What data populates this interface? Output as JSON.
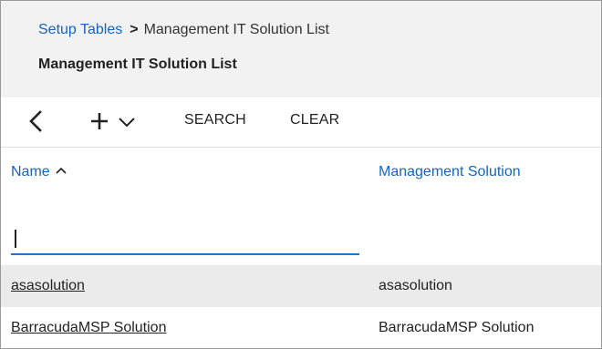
{
  "breadcrumb": {
    "parent": "Setup Tables",
    "separator": ">",
    "current": "Management IT Solution List"
  },
  "page_title": "Management IT Solution List",
  "toolbar": {
    "back_icon": "chevron-left-icon",
    "add_icon": "plus-icon",
    "add_menu_icon": "chevron-down-icon",
    "search_label": "SEARCH",
    "clear_label": "CLEAR"
  },
  "table": {
    "columns": [
      {
        "label": "Name",
        "sort": "ascending",
        "sort_icon": "sort-up-icon"
      },
      {
        "label": "Management Solution"
      }
    ],
    "filter": {
      "name_value": "",
      "placeholder": ""
    },
    "rows": [
      {
        "name": "asasolution",
        "solution": "asasolution"
      },
      {
        "name": "BarracudaMSP Solution",
        "solution": "BarracudaMSP Solution"
      }
    ]
  },
  "colors": {
    "link": "#1565c0",
    "header_bg": "#f2f2f2",
    "row_alt_bg": "#ebebeb",
    "input_underline": "#1976d2"
  }
}
